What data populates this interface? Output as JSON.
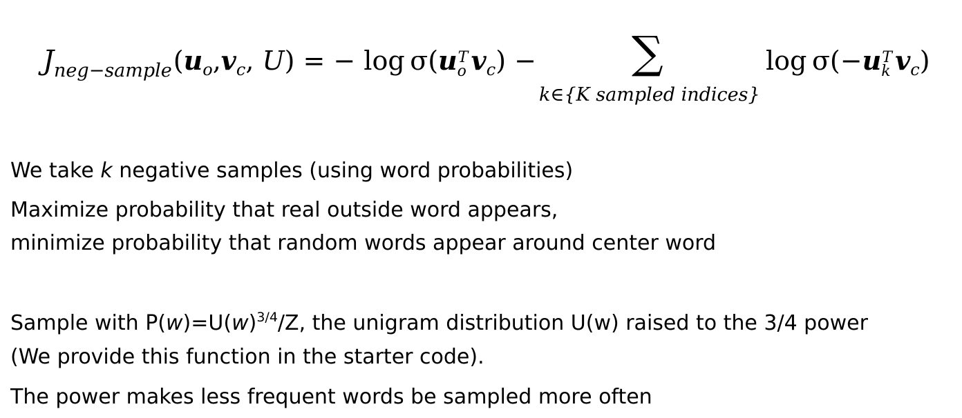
{
  "equation": {
    "lhs_symbol": "J",
    "lhs_subscript": "neg−sample",
    "open_paren": "(",
    "u": "u",
    "u_sub": "o",
    "comma1": ",",
    "v": "v",
    "v_sub": "c",
    "comma2": ",",
    "U": "U",
    "close_paren_eq": ") = − log σ(",
    "u2": "u",
    "u2_sup": "T",
    "u2_sub": "o",
    "v2": "v",
    "v2_sub": "c",
    "close_minus": ") −",
    "sum_symbol": "∑",
    "sum_subscript": "k∈{K sampled indices}",
    "rhs_prefix": "log σ(−",
    "u3": "u",
    "u3_sup": "T",
    "u3_sub": "k",
    "v3": "v",
    "v3_sub": "c",
    "rhs_close": ")"
  },
  "lines": {
    "line1_prefix": "We take ",
    "line1_k": "k",
    "line1_suffix": " negative samples (using word probabilities)",
    "line2": "Maximize probability that real outside word appears,",
    "line3": "minimize probability that random words appear around center word",
    "line4_prefix": "Sample with P(",
    "line4_w1": "w",
    "line4_mid1": ")=U(",
    "line4_w2": "w",
    "line4_mid2": ")",
    "line4_exp": "3/4",
    "line4_suffix": "/Z, the unigram distribution U(w) raised to the 3/4 power",
    "line5": "(We provide this function in the starter code).",
    "line6": "The power makes less frequent words be sampled more often"
  }
}
